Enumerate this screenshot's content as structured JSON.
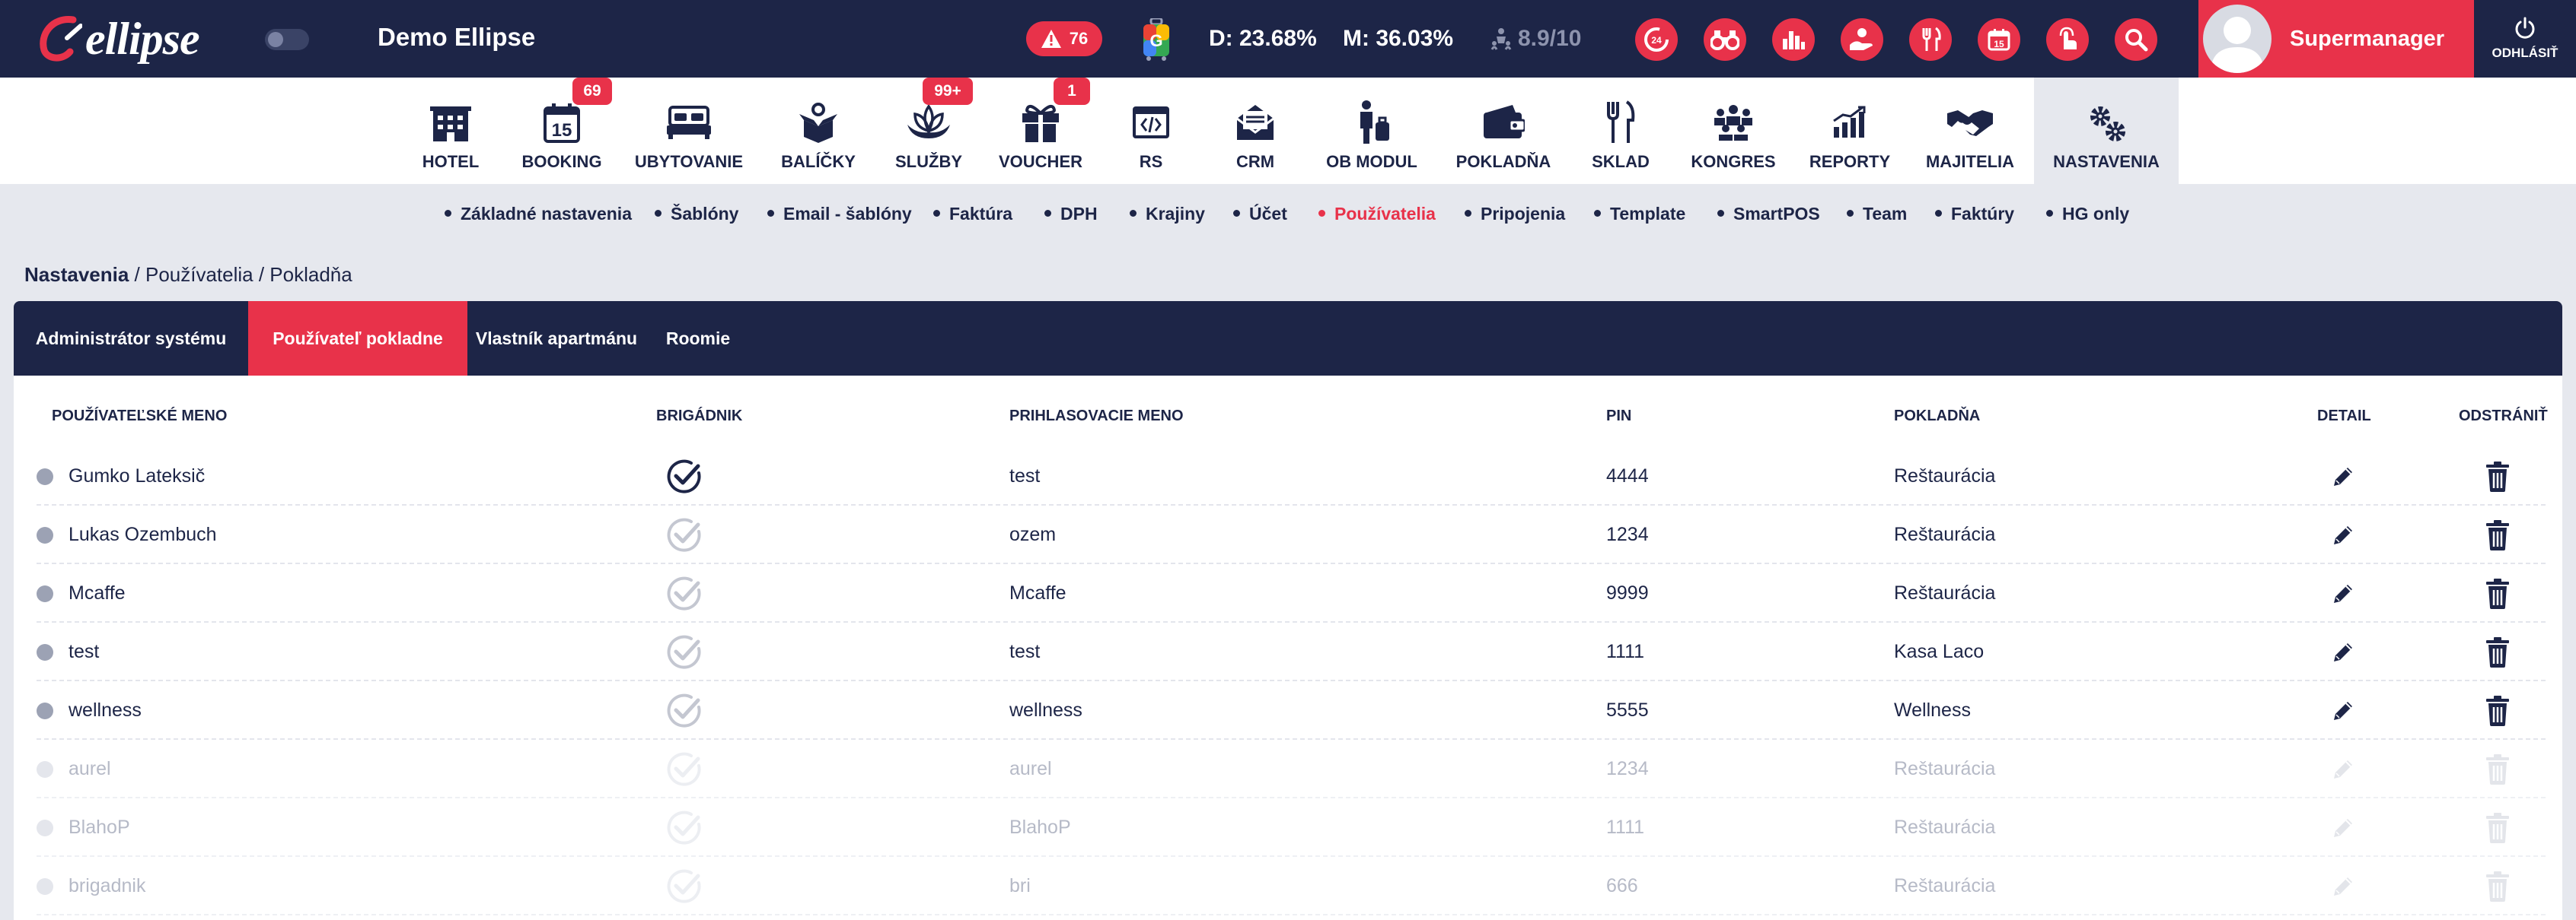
{
  "app": {
    "logo_text": "ellipse",
    "hotel_name": "Demo Ellipse"
  },
  "topbar": {
    "alerts_count": "76",
    "occupancy_day": "D: 23.68%",
    "occupancy_month": "M: 36.03%",
    "rating": "8.9/10",
    "user_name": "Supermanager",
    "logout_label": "ODHLÁSIŤ",
    "quick_icons": [
      "clock-24-icon",
      "binoculars-icon",
      "bar-chart-icon",
      "hand-coins-icon",
      "cutlery-icon",
      "calendar-icon",
      "finger-touch-icon",
      "search-icon"
    ]
  },
  "modules": [
    {
      "label": "HOTEL",
      "icon": "hotel-icon"
    },
    {
      "label": "BOOKING",
      "icon": "calendar-15-icon",
      "badge": "69"
    },
    {
      "label": "UBYTOVANIE",
      "icon": "bed-icon"
    },
    {
      "label": "BALÍČKY",
      "icon": "package-icon"
    },
    {
      "label": "SLUŽBY",
      "icon": "lotus-icon",
      "badge": "99+"
    },
    {
      "label": "VOUCHER",
      "icon": "gift-icon",
      "badge": "1"
    },
    {
      "label": "RS",
      "icon": "code-window-icon"
    },
    {
      "label": "CRM",
      "icon": "envelope-icon"
    },
    {
      "label": "OB MODUL",
      "icon": "traveler-icon"
    },
    {
      "label": "POKLADŇA",
      "icon": "wallet-icon"
    },
    {
      "label": "SKLAD",
      "icon": "fork-knife-icon"
    },
    {
      "label": "KONGRES",
      "icon": "people-group-icon"
    },
    {
      "label": "REPORTY",
      "icon": "growth-chart-icon"
    },
    {
      "label": "MAJITELIA",
      "icon": "handshake-icon"
    },
    {
      "label": "NASTAVENIA",
      "icon": "gears-icon",
      "active": true
    }
  ],
  "subnav": [
    "Základné nastavenia",
    "Šablóny",
    "Email - šablóny",
    "Faktúra",
    "DPH",
    "Krajiny",
    "Účet",
    "Používatelia",
    "Pripojenia",
    "Template",
    "SmartPOS",
    "Team",
    "Faktúry",
    "HG only"
  ],
  "subnav_active": "Používatelia",
  "breadcrumb": {
    "root": "Nastavenia",
    "rest": " / Používatelia / Pokladňa"
  },
  "tabs": [
    "Administrátor systému",
    "Používateľ pokladne",
    "Vlastník apartmánu",
    "Roomie"
  ],
  "tab_active": "Používateľ pokladne",
  "table": {
    "columns": [
      "POUŽÍVATEĽSKÉ MENO",
      "BRIGÁDNIK",
      "PRIHLASOVACIE MENO",
      "PIN",
      "POKLADŇA",
      "DETAIL",
      "ODSTRÁNIŤ"
    ],
    "rows": [
      {
        "name": "Gumko Lateksič",
        "brigadnik": true,
        "login": "test",
        "pin": "4444",
        "pokladna": "Reštaurácia",
        "active": true
      },
      {
        "name": "Lukas Ozembuch",
        "brigadnik": false,
        "login": "ozem",
        "pin": "1234",
        "pokladna": "Reštaurácia",
        "active": true
      },
      {
        "name": "Mcaffe",
        "brigadnik": false,
        "login": "Mcaffe",
        "pin": "9999",
        "pokladna": "Reštaurácia",
        "active": true
      },
      {
        "name": "test",
        "brigadnik": false,
        "login": "test",
        "pin": "1111",
        "pokladna": "Kasa Laco",
        "active": true
      },
      {
        "name": "wellness",
        "brigadnik": false,
        "login": "wellness",
        "pin": "5555",
        "pokladna": "Wellness",
        "active": true
      },
      {
        "name": "aurel",
        "brigadnik": false,
        "login": "aurel",
        "pin": "1234",
        "pokladna": "Reštaurácia",
        "active": false
      },
      {
        "name": "BlahoP",
        "brigadnik": false,
        "login": "BlahoP",
        "pin": "1111",
        "pokladna": "Reštaurácia",
        "active": false
      },
      {
        "name": "brigadnik",
        "brigadnik": false,
        "login": "bri",
        "pin": "666",
        "pokladna": "Reštaurácia",
        "active": false
      }
    ]
  },
  "colors": {
    "navy": "#1d2547",
    "accent": "#e8324a",
    "background": "#e6e8ee"
  }
}
